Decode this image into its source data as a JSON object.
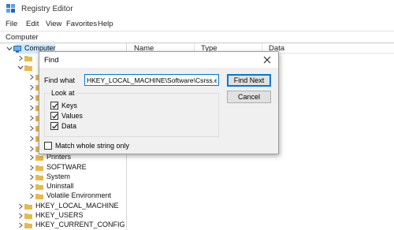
{
  "window": {
    "title": "Registry Editor"
  },
  "menu": [
    "File",
    "Edit",
    "View",
    "Favorites",
    "Help"
  ],
  "address": "Computer",
  "columns": {
    "name": "Name",
    "type": "Type",
    "data": "Data"
  },
  "tree": {
    "root": "Computer",
    "items": [
      {
        "label": "Printers"
      },
      {
        "label": "SOFTWARE"
      },
      {
        "label": "System"
      },
      {
        "label": "Uninstall"
      },
      {
        "label": "Volatile Environment"
      },
      {
        "label": "HKEY_LOCAL_MACHINE"
      },
      {
        "label": "HKEY_USERS"
      },
      {
        "label": "HKEY_CURRENT_CONFIG"
      }
    ]
  },
  "find_dialog": {
    "title": "Find",
    "find_what_label": "Find what",
    "find_what_value": "HKEY_LOCAL_MACHINE\\Software\\Csrss.exe",
    "find_next_label": "Find Next",
    "cancel_label": "Cancel",
    "look_at_label": "Look at",
    "options": [
      {
        "label": "Keys",
        "checked": true
      },
      {
        "label": "Values",
        "checked": true
      },
      {
        "label": "Data",
        "checked": true
      }
    ],
    "match_whole_label": "Match whole string only",
    "match_whole_checked": false
  },
  "colors": {
    "accent": "#0078d7",
    "selection": "#cce8ff",
    "folder": "#e8b94b"
  }
}
